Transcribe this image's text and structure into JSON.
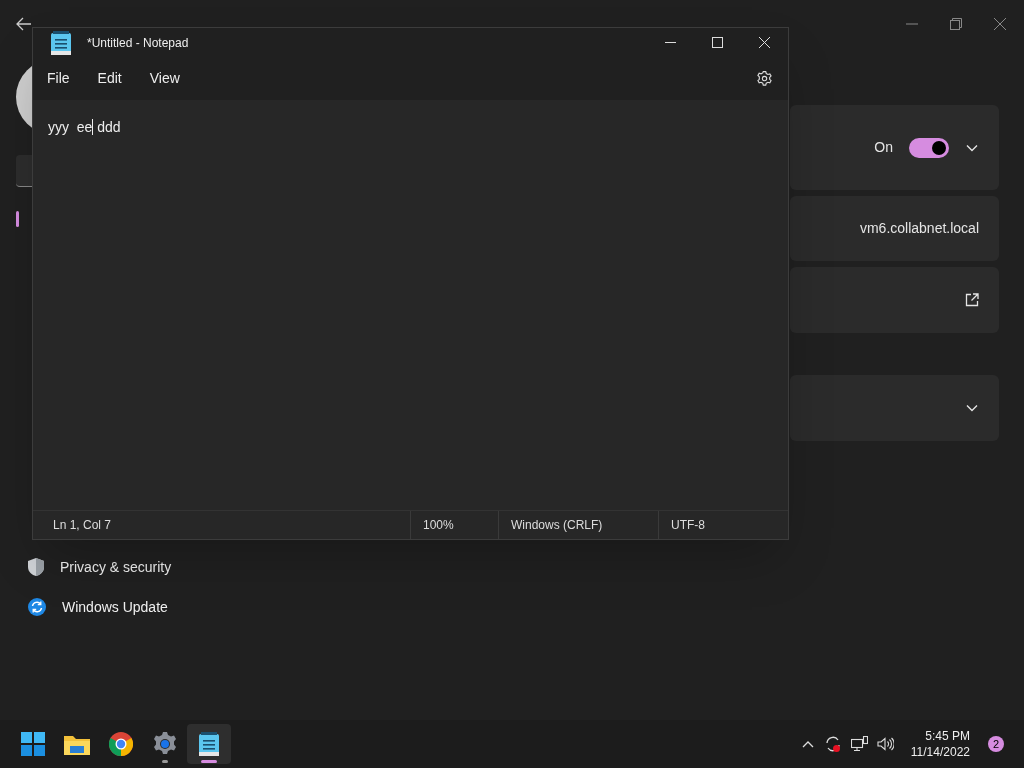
{
  "settings": {
    "nav": [
      {
        "label": "Privacy & security",
        "kind": "shield",
        "selected": false
      },
      {
        "label": "Windows Update",
        "kind": "update",
        "selected": false
      }
    ],
    "cards": [
      {
        "kind": "toggle",
        "state_label": "On",
        "on": true
      },
      {
        "kind": "value",
        "value": "vm6.collabnet.local"
      },
      {
        "kind": "link"
      },
      {
        "kind": "expand"
      }
    ]
  },
  "notepad": {
    "title": "*Untitled - Notepad",
    "menu": [
      "File",
      "Edit",
      "View"
    ],
    "text_before_caret": "yyy  ee",
    "text_after_caret": " ddd",
    "status": [
      "Ln 1, Col 7",
      "100%",
      "Windows (CRLF)",
      "UTF-8"
    ]
  },
  "taskbar": {
    "apps": [
      {
        "kind": "start",
        "running": false,
        "active": false
      },
      {
        "kind": "explorer",
        "running": false,
        "active": false
      },
      {
        "kind": "chrome",
        "running": false,
        "active": false
      },
      {
        "kind": "settings",
        "running": true,
        "active": false
      },
      {
        "kind": "notepad",
        "running": true,
        "active": true
      }
    ],
    "time": "5:45 PM",
    "date": "11/14/2022",
    "notification_count": "2"
  }
}
